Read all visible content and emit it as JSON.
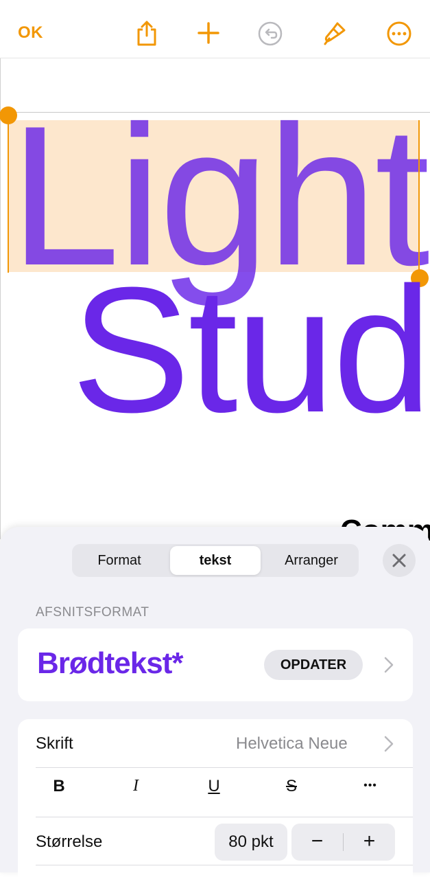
{
  "toolbar": {
    "ok_label": "OK",
    "icons": [
      "share-icon",
      "plus-icon",
      "undo-icon",
      "paintbrush-icon",
      "more-icon"
    ],
    "accent_color": "#f29705",
    "disabled_color": "#b9b9bd"
  },
  "canvas": {
    "word_1": "Light",
    "word_2": "Stud",
    "peek_text": "Comm",
    "text_color": "#6a27e8",
    "selection_color": "#fde7cd"
  },
  "panel": {
    "tabs": [
      {
        "label": "Format",
        "active": false
      },
      {
        "label": "tekst",
        "active": true
      },
      {
        "label": "Arranger",
        "active": false
      }
    ],
    "section_label": "AFSNITSFORMAT",
    "paragraph_style": {
      "name": "Brødtekst*",
      "update_label": "OPDATER"
    },
    "font_row": {
      "label": "Skrift",
      "value": "Helvetica Neue"
    },
    "format_buttons": {
      "bold": "B",
      "italic": "I",
      "underline": "U",
      "strikethrough": "S",
      "more": "•••"
    },
    "size_row": {
      "label": "Størrelse",
      "value": "80 pkt",
      "decrease": "−",
      "increase": "+"
    }
  }
}
